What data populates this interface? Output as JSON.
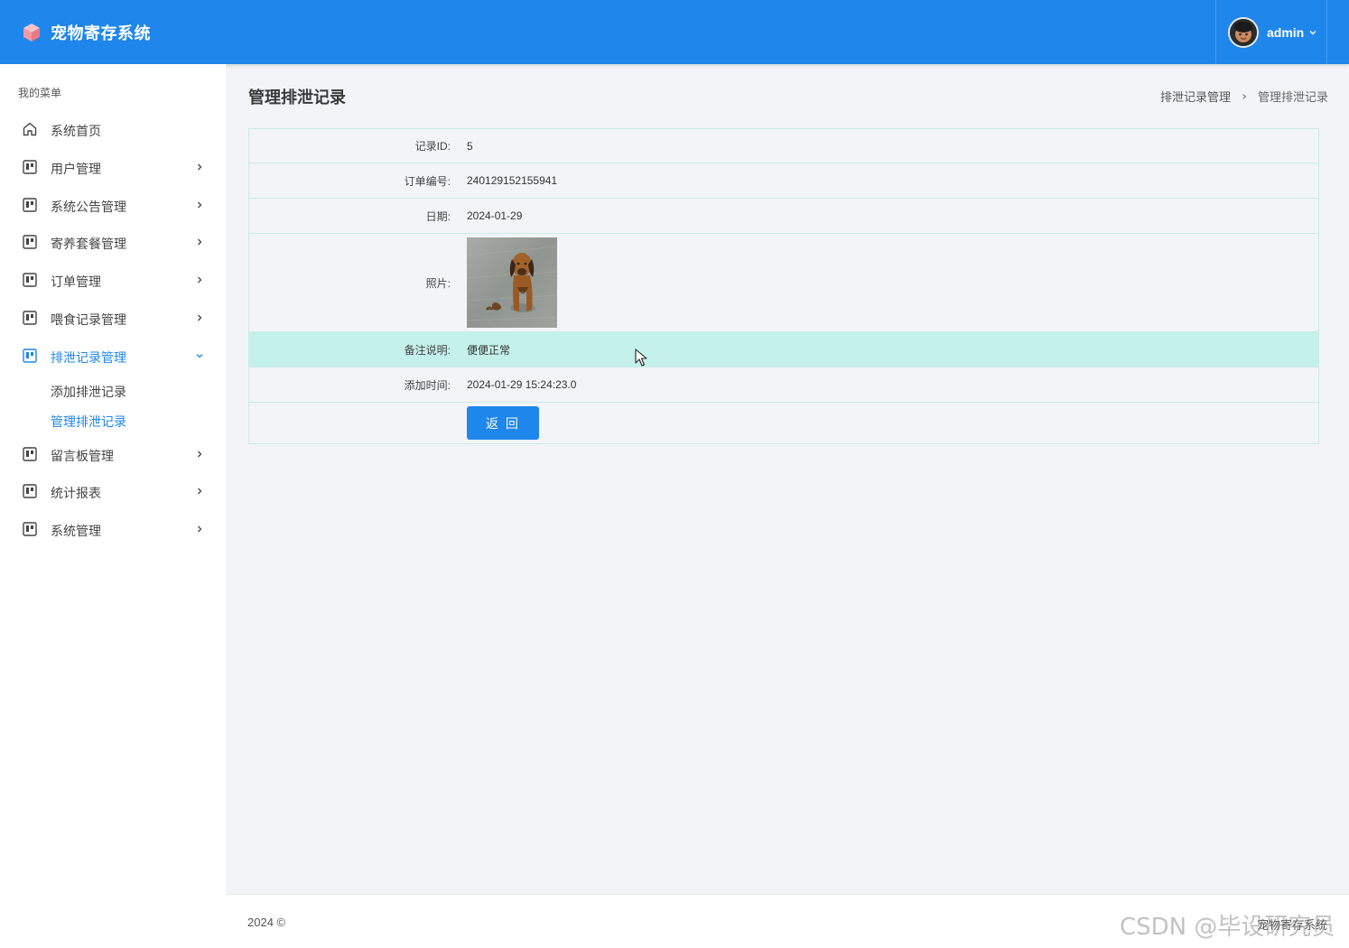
{
  "header": {
    "app_title": "宠物寄存系统",
    "user_name": "admin",
    "brand_color": "#1f86ec"
  },
  "sidebar": {
    "caption": "我的菜单",
    "items": [
      {
        "label": "系统首页",
        "icon": "home-icon"
      },
      {
        "label": "用户管理",
        "icon": "module-icon"
      },
      {
        "label": "系统公告管理",
        "icon": "module-icon"
      },
      {
        "label": "寄养套餐管理",
        "icon": "module-icon"
      },
      {
        "label": "订单管理",
        "icon": "module-icon"
      },
      {
        "label": "喂食记录管理",
        "icon": "module-icon"
      },
      {
        "label": "排泄记录管理",
        "icon": "module-icon",
        "expanded": true
      },
      {
        "label": "留言板管理",
        "icon": "module-icon"
      },
      {
        "label": "统计报表",
        "icon": "module-icon"
      },
      {
        "label": "系统管理",
        "icon": "module-icon"
      }
    ],
    "submenu": [
      {
        "label": "添加排泄记录"
      },
      {
        "label": "管理排泄记录",
        "active": true
      }
    ]
  },
  "main": {
    "page_title": "管理排泄记录",
    "breadcrumb": [
      "排泄记录管理",
      "管理排泄记录"
    ],
    "detail": {
      "record_id_label": "记录ID:",
      "record_id": "5",
      "order_no_label": "订单编号:",
      "order_no": "240129152155941",
      "date_label": "日期:",
      "date": "2024-01-29",
      "photo_label": "照片:",
      "remark_label": "备注说明:",
      "remark": "便便正常",
      "added_time_label": "添加时间:",
      "added_time": "2024-01-29 15:24:23.0"
    },
    "back_button": "返 回"
  },
  "footer": {
    "left": "2024 ©",
    "right": "宠物寄存系统",
    "watermark": "CSDN @毕设研究员"
  }
}
